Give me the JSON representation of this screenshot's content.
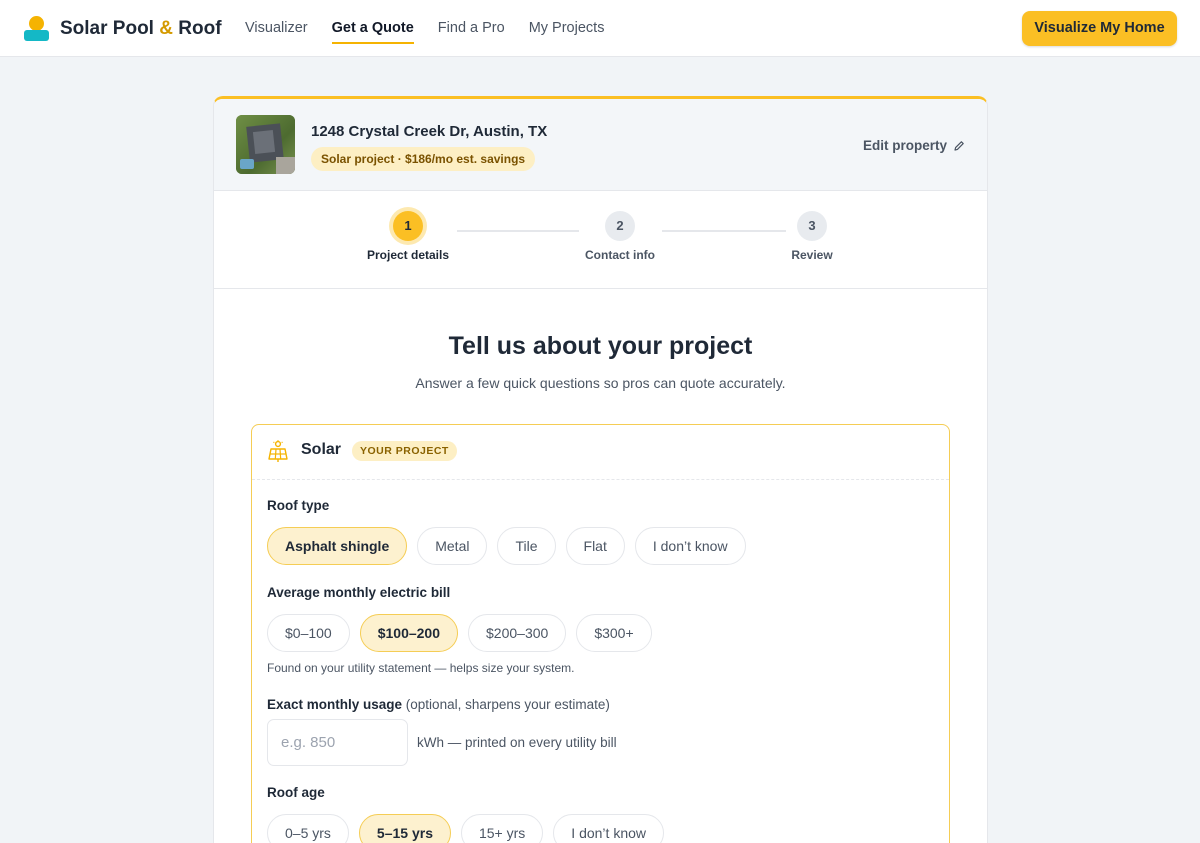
{
  "brand": {
    "name_part1": "Solar Pool ",
    "name_amp": "&",
    "name_part2": " Roof"
  },
  "nav": [
    {
      "label": "Visualizer",
      "active": false
    },
    {
      "label": "Get a Quote",
      "active": true
    },
    {
      "label": "Find a Pro",
      "active": false
    },
    {
      "label": "My Projects",
      "active": false
    }
  ],
  "cta_label": "Visualize My Home",
  "property": {
    "address": "1248 Crystal Creek Dr, Austin, TX",
    "badge": "Solar project · $186/mo est. savings",
    "edit_label": "Edit property"
  },
  "steps": [
    {
      "number": "1",
      "label": "Project details",
      "active": true
    },
    {
      "number": "2",
      "label": "Contact info",
      "active": false
    },
    {
      "number": "3",
      "label": "Review",
      "active": false
    }
  ],
  "heading": "Tell us about your project",
  "subheading": "Answer a few quick questions so pros can quote accurately.",
  "section": {
    "title": "Solar",
    "badge": "YOUR PROJECT",
    "roof_type": {
      "label": "Roof type",
      "options": [
        "Asphalt shingle",
        "Metal",
        "Tile",
        "Flat",
        "I don’t know"
      ],
      "selected": "Asphalt shingle"
    },
    "bill": {
      "label": "Average monthly electric bill",
      "options": [
        "$0–100",
        "$100–200",
        "$200–300",
        "$300+"
      ],
      "selected": "$100–200",
      "hint": "Found on your utility statement — helps size your system."
    },
    "usage": {
      "label": "Exact monthly usage",
      "optional": " (optional, sharpens your estimate)",
      "placeholder": "e.g. 850",
      "value": "",
      "unit_note": "kWh — printed on every utility bill"
    },
    "roof_age": {
      "label": "Roof age",
      "options": [
        "0–5 yrs",
        "5–15 yrs",
        "15+ yrs",
        "I don’t know"
      ],
      "selected": "5–15 yrs"
    }
  },
  "colors": {
    "accent": "#fbbf24",
    "accent_soft": "#fdf1cf",
    "teal": "#14b8c6"
  }
}
